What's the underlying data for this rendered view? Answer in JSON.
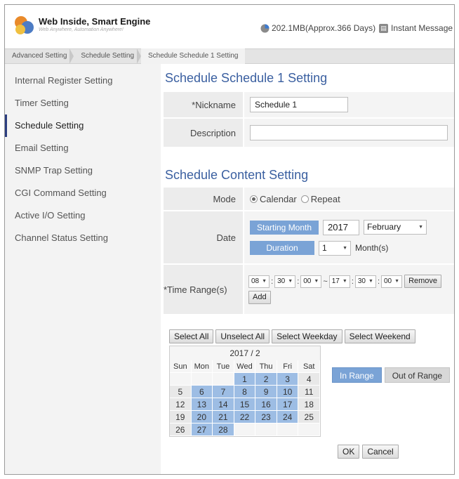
{
  "header": {
    "brand_title": "Web Inside, Smart Engine",
    "brand_sub": "Web Anywhere, Automation Anywhere!",
    "storage_text": "202.1MB(Approx.366 Days)",
    "im_label": "Instant Message"
  },
  "breadcrumb": [
    "Advanced Setting",
    "Schedule Setting",
    "Schedule Schedule 1 Setting"
  ],
  "sidebar": {
    "items": [
      {
        "label": "Internal Register Setting"
      },
      {
        "label": "Timer Setting"
      },
      {
        "label": "Schedule Setting"
      },
      {
        "label": "Email Setting"
      },
      {
        "label": "SNMP Trap Setting"
      },
      {
        "label": "CGI Command Setting"
      },
      {
        "label": "Active I/O Setting"
      },
      {
        "label": "Channel Status Setting"
      }
    ]
  },
  "main": {
    "title": "Schedule Schedule 1 Setting",
    "nickname_label": "*Nickname",
    "nickname_value": "Schedule 1",
    "description_label": "Description",
    "description_value": "",
    "content_title": "Schedule Content Setting",
    "mode_label": "Mode",
    "mode_calendar": "Calendar",
    "mode_repeat": "Repeat",
    "date_label": "Date",
    "starting_month_label": "Starting Month",
    "year": "2017",
    "month": "February",
    "duration_label": "Duration",
    "duration_value": "1",
    "duration_unit": "Month(s)",
    "time_range_label": "*Time Range(s)",
    "time": {
      "h1": "08",
      "m1": "30",
      "s1": "00",
      "tilde": "~",
      "h2": "17",
      "m2": "30",
      "s2": "00",
      "colon": ":"
    },
    "remove_label": "Remove",
    "add_label": "Add"
  },
  "calendar": {
    "select_all": "Select All",
    "unselect_all": "Unselect All",
    "select_weekday": "Select Weekday",
    "select_weekend": "Select Weekend",
    "title": "2017 / 2",
    "dow": [
      "Sun",
      "Mon",
      "Tue",
      "Wed",
      "Thu",
      "Fri",
      "Sat"
    ],
    "in_range": "In Range",
    "out_of_range": "Out of Range",
    "ok": "OK",
    "cancel": "Cancel"
  },
  "colors": {
    "accent": "#3a5fa0",
    "pill": "#7aa3d6",
    "selected_day": "#9dbde4"
  }
}
